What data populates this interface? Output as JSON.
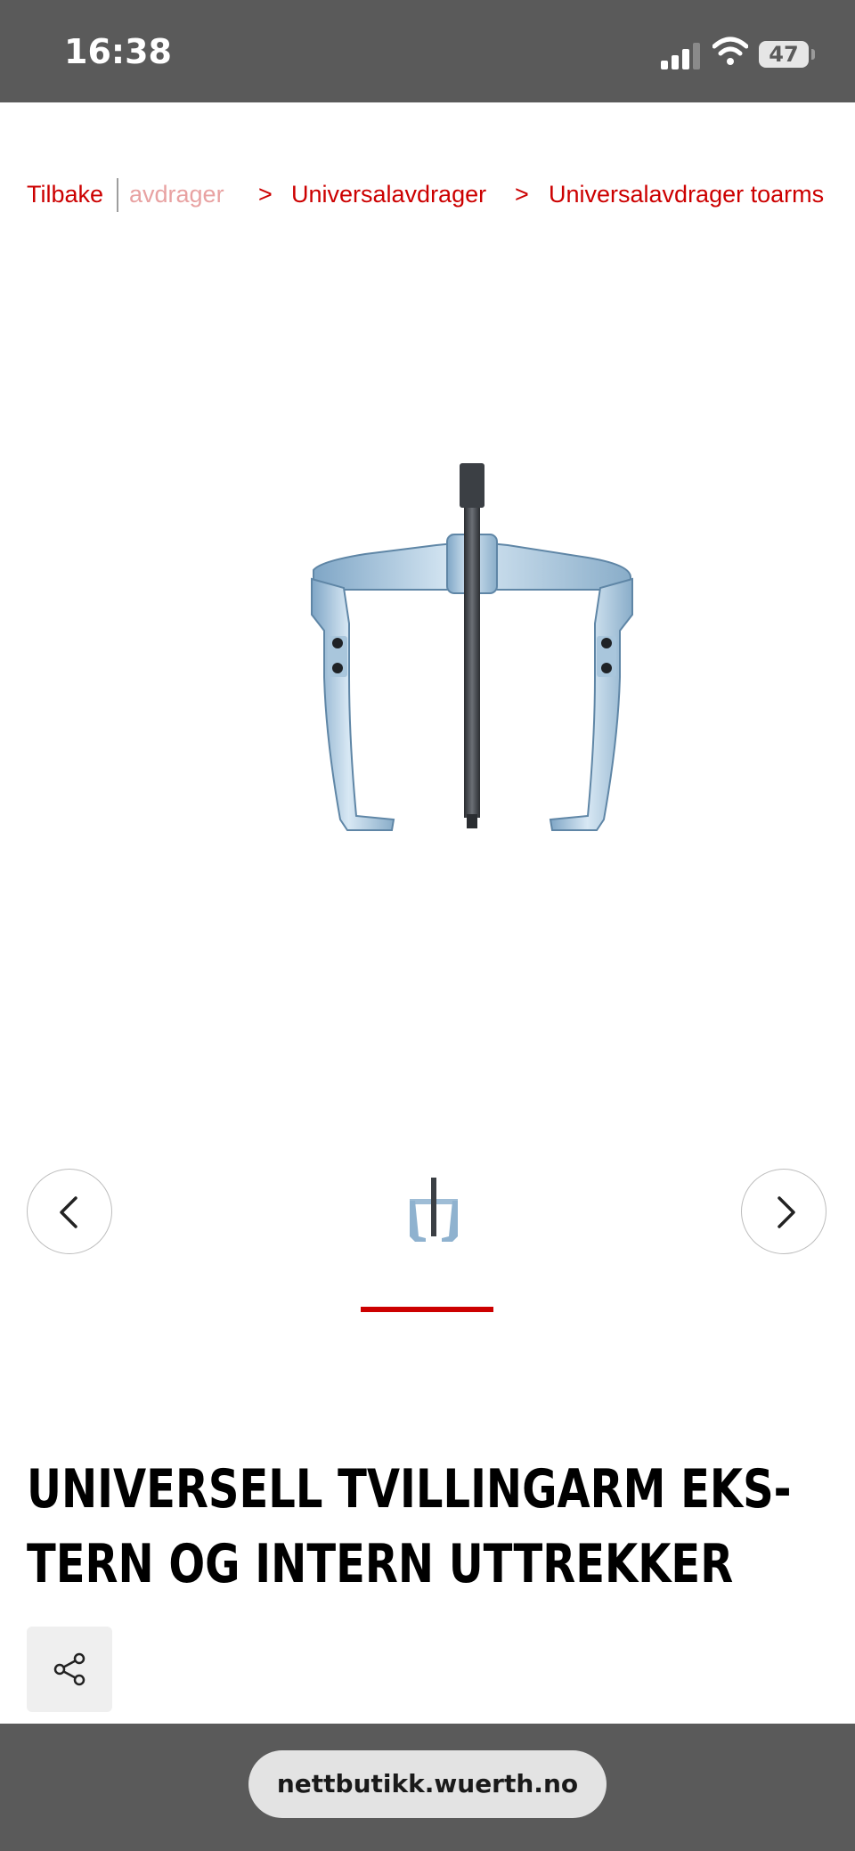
{
  "status_bar": {
    "time": "16:38",
    "battery_level": "47",
    "icons": [
      "cellular-signal-icon",
      "wifi-icon",
      "battery-icon"
    ]
  },
  "breadcrumb": {
    "back_label": "Tilbake",
    "items": [
      "avdrager",
      "Universalavdrager",
      "Universalavdrager toarms"
    ],
    "separator": ">"
  },
  "gallery": {
    "prev_icon": "chevron-left-icon",
    "next_icon": "chevron-right-icon",
    "image_count": 1,
    "active_index": 0
  },
  "product": {
    "title_line1": "UNIVERSELL TVILLINGARM EKS-",
    "title_line2": "TERN OG INTERN UTTREKKER",
    "share_icon": "share-icon"
  },
  "browser": {
    "url": "nettbutikk.wuerth.no"
  },
  "colors": {
    "accent": "#cc0000",
    "bar_background": "#5a5a5a"
  }
}
